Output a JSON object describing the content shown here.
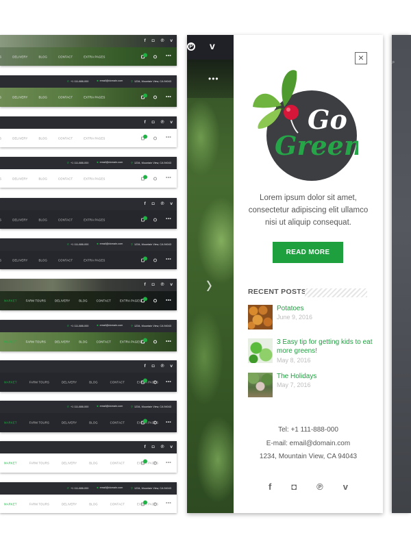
{
  "colors": {
    "accent": "#1ea03f",
    "dark_bar": "#2b2c32",
    "text_muted": "#bdbdbd"
  },
  "header_variants": {
    "social_icons": [
      "f",
      "◘",
      "℗",
      "v"
    ],
    "contact": {
      "phone": "+1 111-888-000",
      "email": "email@domain.com",
      "address": "1234, Mountain View, CA 94043"
    },
    "nav_short": [
      "RS",
      "DELIVERY",
      "BLOG",
      "CONTACT",
      "EXTRA PAGES"
    ],
    "nav_full": [
      "MARKET",
      "FARM TOURS",
      "DELIVERY",
      "BLOG",
      "CONTACT",
      "EXTRA PAGES"
    ],
    "more_icon": "•••"
  },
  "left_social": {
    "pinterest": "P",
    "vimeo": "v",
    "more": "•••"
  },
  "sidebar": {
    "close_icon": "×",
    "logo": {
      "line1": "Go",
      "line2": "Green"
    },
    "intro_text": "Lorem ipsum dolor sit amet, consectetur adipiscing elit ullamco nisi ut aliquip consequat.",
    "read_more_label": "READ MORE",
    "recent_posts_title": "RECENT POSTS",
    "posts": [
      {
        "title": "Potatoes",
        "date": "June 9, 2016",
        "thumb": "potatoes"
      },
      {
        "title": "3 Easy tip for getting kids to eat more greens!",
        "date": "May 8, 2016",
        "thumb": "greens"
      },
      {
        "title": "The Holidays",
        "date": "May 7, 2016",
        "thumb": "holidays"
      }
    ],
    "contact": {
      "phone": "Tel: +1 111-888-000",
      "email": "E-mail: email@domain.com",
      "address": "1234, Mountain View, CA 94043"
    },
    "footer_social": [
      "f",
      "◘",
      "℗",
      "v"
    ]
  }
}
